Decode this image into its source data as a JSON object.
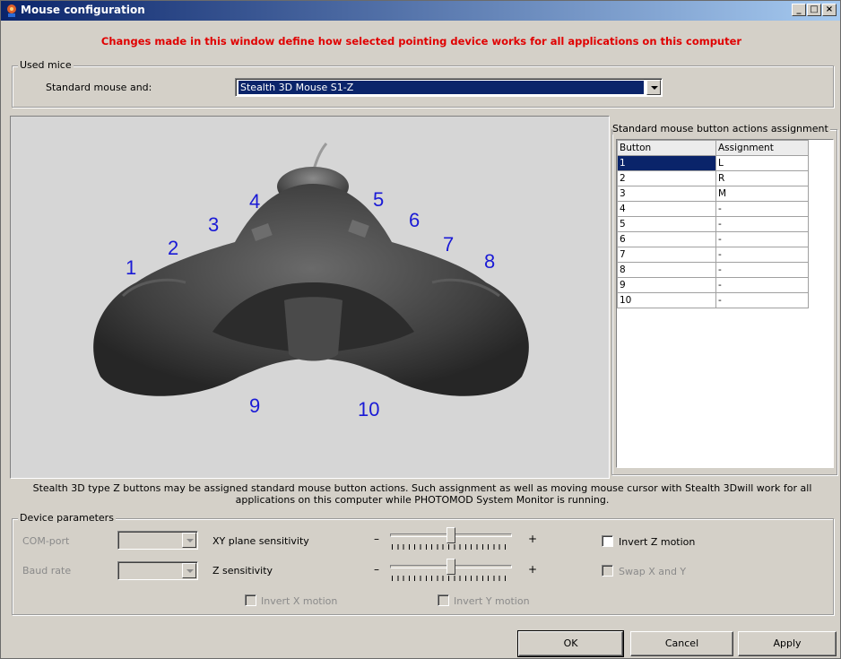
{
  "window": {
    "title": "Mouse configuration",
    "notice": "Changes made in this window define how selected pointing device works for all applications on this computer"
  },
  "used_mice": {
    "legend": "Used mice",
    "label": "Standard mouse and:",
    "selected": "Stealth 3D Mouse S1-Z"
  },
  "image": {
    "button_numbers": [
      "1",
      "2",
      "3",
      "4",
      "5",
      "6",
      "7",
      "8",
      "9",
      "10"
    ]
  },
  "assignment": {
    "legend": "Standard mouse button actions assignment",
    "columns": [
      "Button",
      "Assignment"
    ],
    "rows": [
      [
        "1",
        "L"
      ],
      [
        "2",
        "R"
      ],
      [
        "3",
        "M"
      ],
      [
        "4",
        "-"
      ],
      [
        "5",
        "-"
      ],
      [
        "6",
        "-"
      ],
      [
        "7",
        "-"
      ],
      [
        "8",
        "-"
      ],
      [
        "9",
        "-"
      ],
      [
        "10",
        "-"
      ]
    ]
  },
  "description": "Stealth 3D type Z buttons may be assigned standard mouse button actions. Such assignment as well as moving mouse cursor with Stealth 3Dwill work for all applications on this computer while PHOTOMOD System Monitor is running.",
  "device": {
    "legend": "Device parameters",
    "com_port_label": "COM-port",
    "baud_rate_label": "Baud rate",
    "xy_label": "XY plane sensitivity",
    "z_label": "Z sensitivity",
    "minus": "–",
    "plus": "+",
    "xy_level": 0.5,
    "z_level": 0.5,
    "invert_z": "Invert Z motion",
    "swap_xy": "Swap X and Y",
    "invert_x": "Invert X motion",
    "invert_y": "Invert Y motion"
  },
  "buttons": {
    "ok": "OK",
    "cancel": "Cancel",
    "apply": "Apply"
  },
  "colors": {
    "title_start": "#0a246a",
    "title_end": "#a6caf0",
    "notice": "#e00000",
    "button_numbers": "#1a1ad6"
  }
}
